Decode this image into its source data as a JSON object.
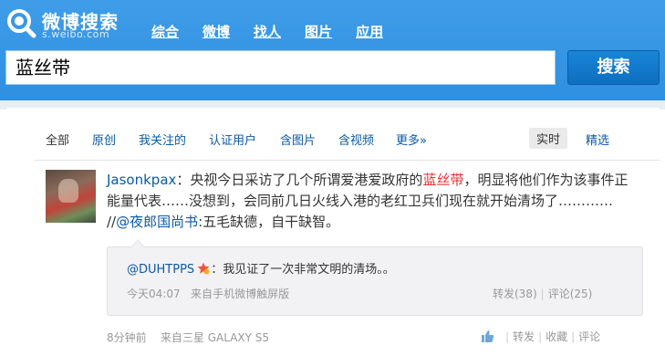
{
  "header": {
    "logo_title": "微博搜索",
    "logo_sub": "s.weibo.com",
    "nav": [
      "综合",
      "微博",
      "找人",
      "图片",
      "应用"
    ]
  },
  "search": {
    "query": "蓝丝带",
    "button_label": "搜索"
  },
  "filters": {
    "items": [
      "全部",
      "原创",
      "我关注的",
      "认证用户",
      "含图片",
      "含视频",
      "更多»"
    ],
    "sort_realtime": "实时",
    "sort_featured": "精选"
  },
  "post": {
    "username": "Jasonkpax",
    "colon": "：",
    "text_before": "央视今日采访了几个所谓爱港爱政府的",
    "keyword": "蓝丝带",
    "text_after": "，明显将他们作为该事件正能量代表……没想到，会同前几日火线入港的老红卫兵们现在就开始清场了………… //",
    "mention": "@夜郎国尚书",
    "text_tail": ":五毛缺德，自干缺智。",
    "time": "8分钟前",
    "source_prefix": "来自",
    "source": "三星 GALAXY S5",
    "actions": {
      "repost": "转发",
      "favorite": "收藏",
      "comment": "评论"
    }
  },
  "repost": {
    "author": "@DUHTPPS",
    "text": "：我见证了一次非常文明的清场。。",
    "time": "今天04:07",
    "source_prefix": "来自",
    "source": "手机微博触屏版",
    "repost_count": "转发(38)",
    "comment_count": "评论(25)"
  },
  "colors": {
    "header_blue": "#3f9de8",
    "link_blue": "#0a5aa6",
    "keyword_red": "#e4312f",
    "search_button": "#1a85d6"
  },
  "icons": {
    "logo": "weibo-search-logo-icon",
    "vip": "vip-badge-icon",
    "like": "thumbs-up-icon"
  }
}
